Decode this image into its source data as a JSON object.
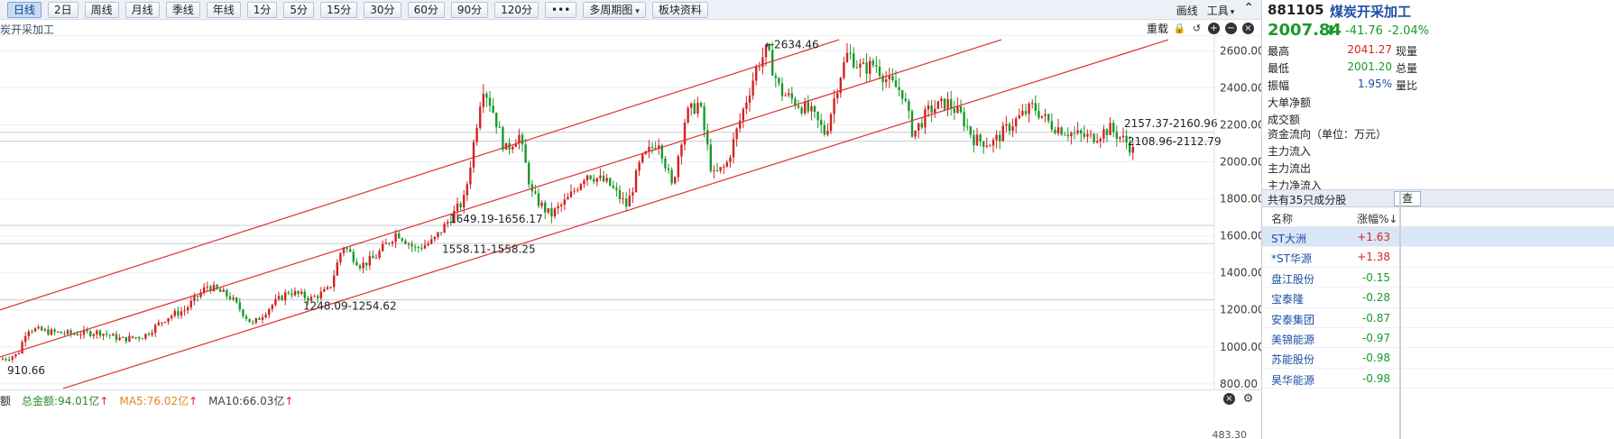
{
  "toolbar": {
    "periods": [
      "日线",
      "2日",
      "周线",
      "月线",
      "季线",
      "年线",
      "1分",
      "5分",
      "15分",
      "30分",
      "60分",
      "90分",
      "120分",
      "•••",
      "多周期图",
      "板块资料"
    ],
    "active_period": "日线",
    "right": {
      "draw_line": "画线",
      "tools": "工具"
    }
  },
  "caption": {
    "name": "炭开采加工",
    "restore": "重载"
  },
  "chart_data": {
    "type": "candlestick",
    "y_ticks": [
      "2600.00",
      "2400.00",
      "2200.00",
      "2000.00",
      "1800.00",
      "1600.00",
      "1400.00",
      "1200.00",
      "1000.00",
      "800.00"
    ],
    "ylim": [
      770,
      2680
    ],
    "annotations": [
      {
        "text": "←2634.46",
        "value": 2634.46
      },
      {
        "text": "2157.37-2160.96",
        "value": 2159
      },
      {
        "text": "2108.96-2112.79",
        "value": 2111
      },
      {
        "text": "1649.19-1656.17",
        "value": 1652
      },
      {
        "text": "1558.11-1558.25",
        "value": 1558
      },
      {
        "text": "1248.09-1254.62",
        "value": 1251
      },
      {
        "text": "910.66",
        "value": 910.66
      }
    ],
    "horizontal_levels": [
      1656,
      1558,
      1254,
      2160,
      2112
    ],
    "trend_channel": {
      "color": "#e03030",
      "lines": [
        {
          "from": [
            0,
            1200
          ],
          "to": [
            930,
            2660
          ]
        },
        {
          "from": [
            0,
            945
          ],
          "to": [
            1110,
            2660
          ]
        },
        {
          "from": [
            70,
            775
          ],
          "to": [
            1295,
            2660
          ]
        }
      ]
    },
    "path_anchors": [
      [
        0,
        930
      ],
      [
        20,
        960
      ],
      [
        30,
        1100
      ],
      [
        55,
        1080
      ],
      [
        80,
        1070
      ],
      [
        110,
        1080
      ],
      [
        135,
        1040
      ],
      [
        160,
        1060
      ],
      [
        185,
        1160
      ],
      [
        205,
        1200
      ],
      [
        230,
        1330
      ],
      [
        255,
        1270
      ],
      [
        280,
        1120
      ],
      [
        300,
        1220
      ],
      [
        320,
        1300
      ],
      [
        345,
        1260
      ],
      [
        365,
        1310
      ],
      [
        380,
        1550
      ],
      [
        400,
        1440
      ],
      [
        415,
        1480
      ],
      [
        440,
        1620
      ],
      [
        460,
        1530
      ],
      [
        480,
        1570
      ],
      [
        500,
        1700
      ],
      [
        515,
        1800
      ],
      [
        525,
        2100
      ],
      [
        535,
        2420
      ],
      [
        545,
        2300
      ],
      [
        560,
        2060
      ],
      [
        575,
        2150
      ],
      [
        590,
        1820
      ],
      [
        610,
        1710
      ],
      [
        630,
        1800
      ],
      [
        650,
        1940
      ],
      [
        675,
        1880
      ],
      [
        695,
        1760
      ],
      [
        710,
        2000
      ],
      [
        730,
        2120
      ],
      [
        745,
        1860
      ],
      [
        760,
        2250
      ],
      [
        775,
        2320
      ],
      [
        790,
        1920
      ],
      [
        805,
        1980
      ],
      [
        825,
        2300
      ],
      [
        840,
        2530
      ],
      [
        850,
        2600
      ],
      [
        865,
        2380
      ],
      [
        880,
        2330
      ],
      [
        900,
        2260
      ],
      [
        915,
        2150
      ],
      [
        930,
        2450
      ],
      [
        940,
        2590
      ],
      [
        955,
        2500
      ],
      [
        970,
        2530
      ],
      [
        985,
        2430
      ],
      [
        1000,
        2380
      ],
      [
        1012,
        2150
      ],
      [
        1030,
        2280
      ],
      [
        1050,
        2320
      ],
      [
        1065,
        2250
      ],
      [
        1080,
        2120
      ],
      [
        1100,
        2100
      ],
      [
        1120,
        2200
      ],
      [
        1145,
        2300
      ],
      [
        1165,
        2200
      ],
      [
        1190,
        2150
      ],
      [
        1210,
        2130
      ],
      [
        1230,
        2180
      ],
      [
        1250,
        2100
      ],
      [
        1260,
        2030
      ]
    ]
  },
  "volume": {
    "label": "额",
    "amount": "总金额:94.01亿",
    "ma5": "MA5:76.02亿",
    "ma10": "MA10:66.03亿",
    "bottom_value": "483.30"
  },
  "quote": {
    "code": "881105",
    "name": "煤炭开采加工",
    "price": "2007.84",
    "change": "-41.76",
    "change_pct": "-2.04%"
  },
  "stats": [
    {
      "label": "最高",
      "value": "2041.27",
      "color": "red",
      "label2": "现量"
    },
    {
      "label": "最低",
      "value": "2001.20",
      "color": "green",
      "label2": "总量"
    },
    {
      "label": "振幅",
      "value": "1.95%",
      "color": "blue",
      "label2": "量比"
    },
    {
      "label": "大单净额",
      "value": "",
      "color": "blue",
      "label2": ""
    },
    {
      "label": "成交额",
      "value": "",
      "color": "blue",
      "label2": ""
    }
  ],
  "flow": {
    "title": "资金流向（单位：万元）",
    "rows": [
      "主力流入",
      "主力流出",
      "主力净流入"
    ]
  },
  "constituents": {
    "title": "共有35只成分股",
    "search": "查",
    "col_name": "名称",
    "col_pct": "涨幅%↓",
    "rows": [
      {
        "name": "ST大洲",
        "pct": "+1.63",
        "color": "red"
      },
      {
        "name": "*ST华源",
        "pct": "+1.38",
        "color": "red"
      },
      {
        "name": "盘江股份",
        "pct": "-0.15",
        "color": "green"
      },
      {
        "name": "宝泰隆",
        "pct": "-0.28",
        "color": "green"
      },
      {
        "name": "安泰集团",
        "pct": "-0.87",
        "color": "green"
      },
      {
        "name": "美锦能源",
        "pct": "-0.97",
        "color": "green"
      },
      {
        "name": "苏能股份",
        "pct": "-0.98",
        "color": "green"
      },
      {
        "name": "昊华能源",
        "pct": "-0.98",
        "color": "green"
      }
    ]
  },
  "colors": {
    "up": "#d22222",
    "down": "#199a2a",
    "trend": "#e03030",
    "accent": "#1d4fa6"
  }
}
